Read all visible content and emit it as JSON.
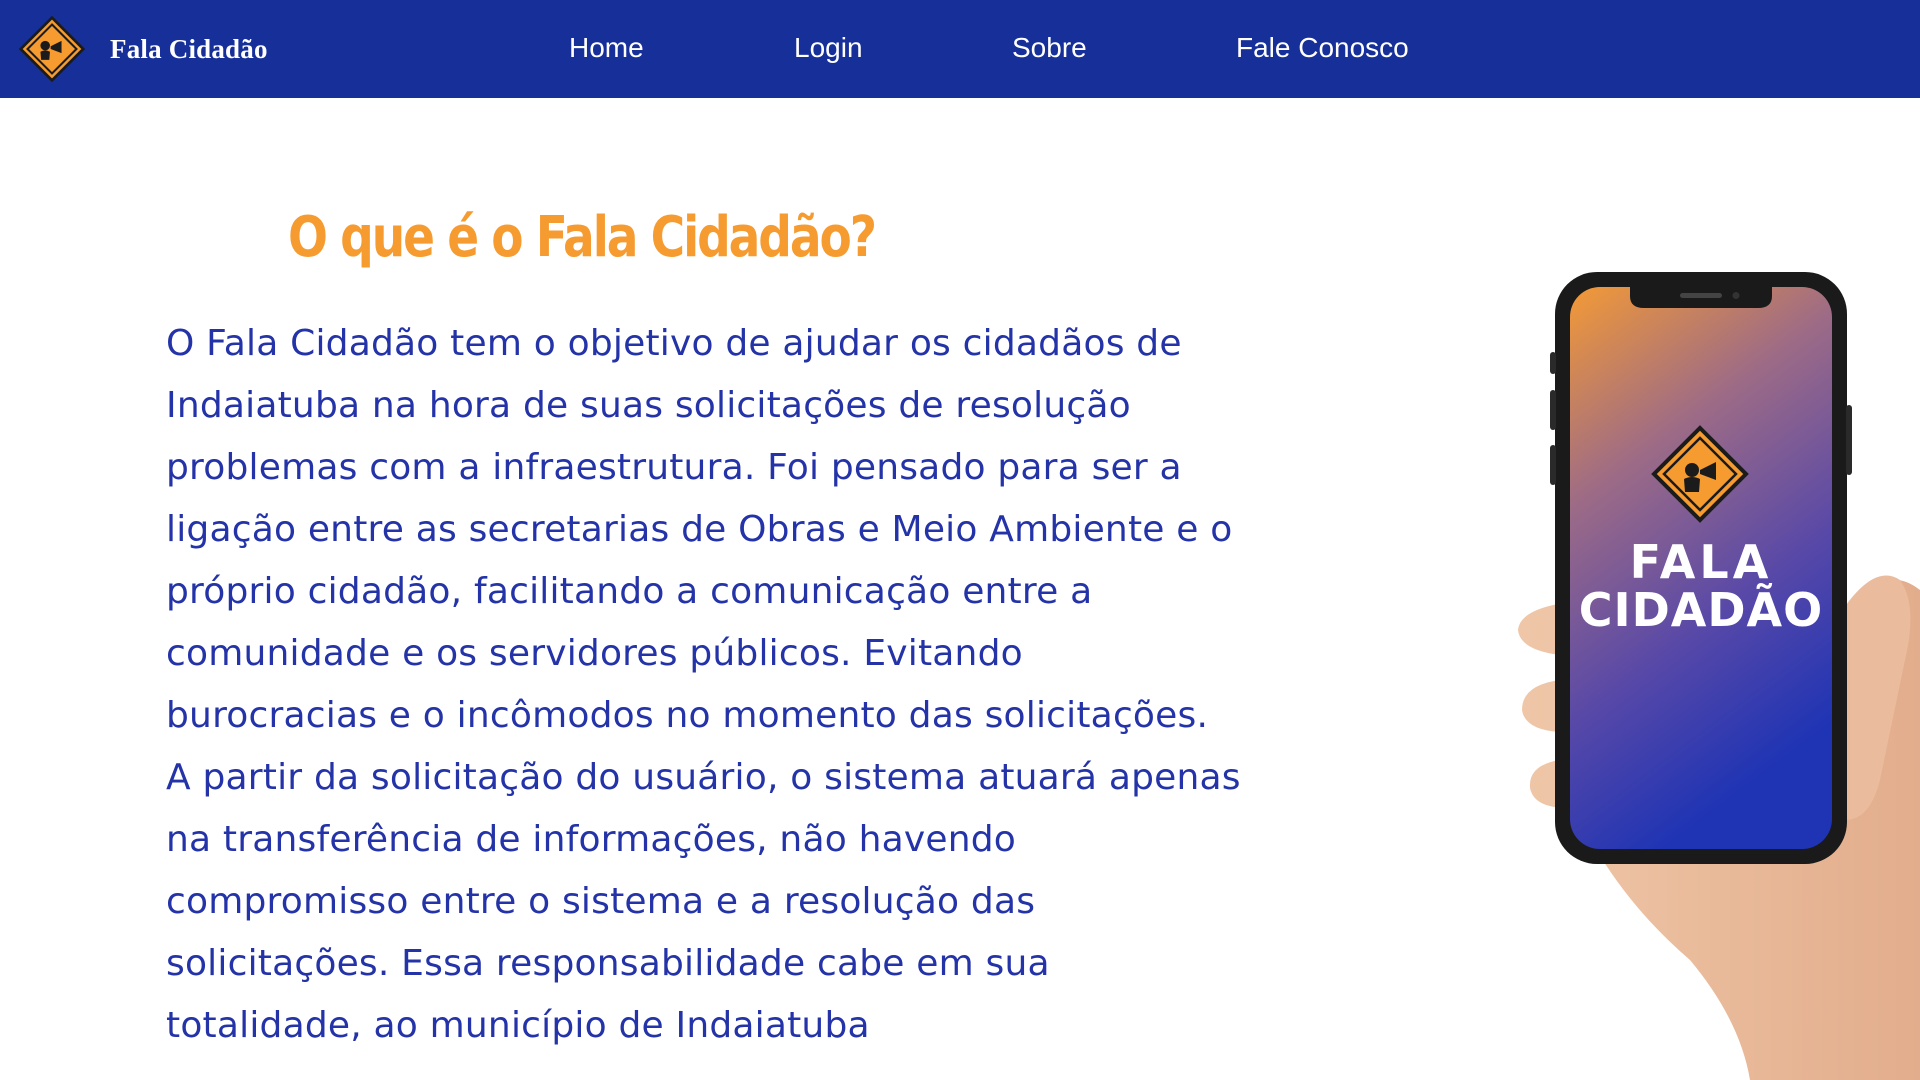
{
  "navbar": {
    "brand": "Fala Cidadão",
    "logo_icon": "road-sign-megaphone-icon",
    "links": [
      {
        "label": "Home"
      },
      {
        "label": "Login"
      },
      {
        "label": "Sobre"
      },
      {
        "label": "Fale Conosco"
      }
    ]
  },
  "hero": {
    "title": "O que é o Fala Cidadão?",
    "lines": [
      "O Fala Cidadão tem o objetivo de ajudar os cidadãos de",
      "Indaiatuba na hora de suas solicitações de resolução",
      "problemas com a infraestrutura. Foi pensado para ser a",
      "ligação entre as secretarias de Obras e Meio Ambiente e o",
      "próprio cidadão, facilitando a comunicação entre a",
      "comunidade e os servidores públicos. Evitando",
      "burocracias e o incômodos no momento das solicitações.",
      "A partir da solicitação do usuário, o sistema atuará apenas",
      "na transferência de informações, não havendo",
      "compromisso entre o sistema e a resolução das",
      "solicitações. Essa responsabilidade cabe em sua",
      "totalidade, ao município de Indaiatuba"
    ]
  },
  "phone": {
    "screen_line1": "FALA",
    "screen_line2": "CIDADÃO",
    "image": "hand-holding-phone-image"
  },
  "colors": {
    "navbar": "#172f98",
    "title": "#f59b30",
    "body_text": "#2434a8",
    "logo_fill": "#f59b30"
  }
}
